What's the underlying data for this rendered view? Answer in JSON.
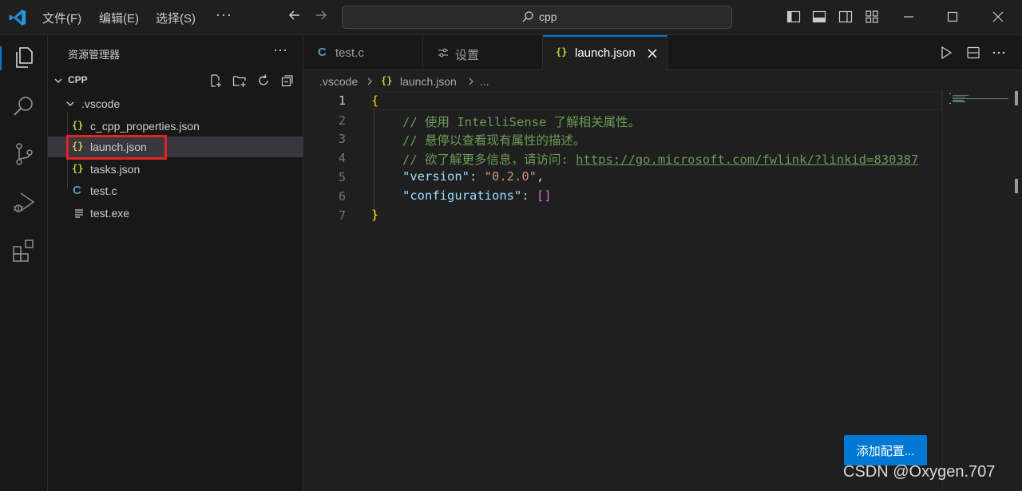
{
  "titlebar": {
    "menu": [
      "文件(F)",
      "编辑(E)",
      "选择(S)"
    ],
    "more": "···",
    "search": "cpp"
  },
  "sidebar": {
    "title": "资源管理器",
    "more": "···",
    "folder": "CPP",
    "subfolder": ".vscode",
    "files": [
      {
        "name": "c_cpp_properties.json",
        "icon": "json-icon"
      },
      {
        "name": "launch.json",
        "icon": "json-icon",
        "active": true
      },
      {
        "name": "tasks.json",
        "icon": "json-icon"
      },
      {
        "name": "test.c",
        "icon": "c-file-icon"
      },
      {
        "name": "test.exe",
        "icon": "file-lines-icon"
      }
    ]
  },
  "tabs": [
    {
      "label": "test.c",
      "icon": "C"
    },
    {
      "label": "设置",
      "icon": "settings-sliders-icon"
    },
    {
      "label": "launch.json",
      "icon": "{}",
      "active": true
    }
  ],
  "breadcrumb": {
    "folder": ".vscode",
    "file": "launch.json",
    "more": "..."
  },
  "editor": {
    "line_numbers": [
      "1",
      "2",
      "3",
      "4",
      "5",
      "6",
      "7"
    ],
    "current_line": "1",
    "brace_open": "{",
    "brace_close": "}",
    "comment1": "// 使用 IntelliSense 了解相关属性。",
    "comment2": "// 悬停以查看现有属性的描述。",
    "comment3_text": "// 欲了解更多信息，请访问: ",
    "comment3_link": "https://go.microsoft.com/fwlink/?linkid=830387",
    "version_key": "\"version\"",
    "version_value": "\"0.2.0\"",
    "config_key": "\"configurations\"",
    "config_value": "[]"
  },
  "add_config_button": "添加配置...",
  "watermark": "CSDN @Oxygen.707",
  "colors": {
    "accent": "#0078d4",
    "highlight_box": "#e02424",
    "json_icon": "#cbcb41",
    "c_icon": "#519aba"
  }
}
